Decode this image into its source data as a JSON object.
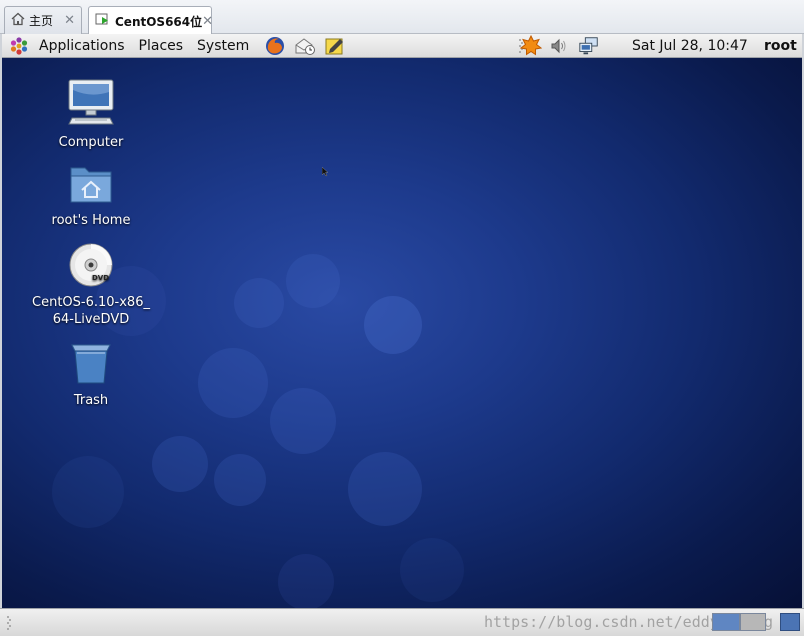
{
  "tabs": [
    {
      "label": "主页",
      "icon": "home-icon",
      "active": false
    },
    {
      "label": "CentOS664位",
      "icon": "vm-icon",
      "active": true
    }
  ],
  "panel": {
    "menus": [
      "Applications",
      "Places",
      "System"
    ],
    "launchers": [
      "firefox-icon",
      "mail-clock-icon",
      "notes-icon"
    ],
    "tray": [
      "updates-icon",
      "volume-icon",
      "network-icon"
    ],
    "clock": "Sat Jul 28, 10:47",
    "user": "root"
  },
  "desktop": {
    "icons": [
      {
        "label": "Computer",
        "icon": "computer-icon"
      },
      {
        "label": "root's Home",
        "icon": "home-folder-icon"
      },
      {
        "label_line1": "CentOS-6.10-x86_",
        "label_line2": "64-LiveDVD",
        "icon": "dvd-icon"
      },
      {
        "label": "Trash",
        "icon": "trash-icon"
      }
    ]
  },
  "bottom": {
    "watermark": "https://blog.csdn.net/eddy_Zhang"
  },
  "colors": {
    "desktop_center": "#2a4aa4",
    "desktop_edge": "#061036",
    "workspace_active": "#5f86c2"
  }
}
